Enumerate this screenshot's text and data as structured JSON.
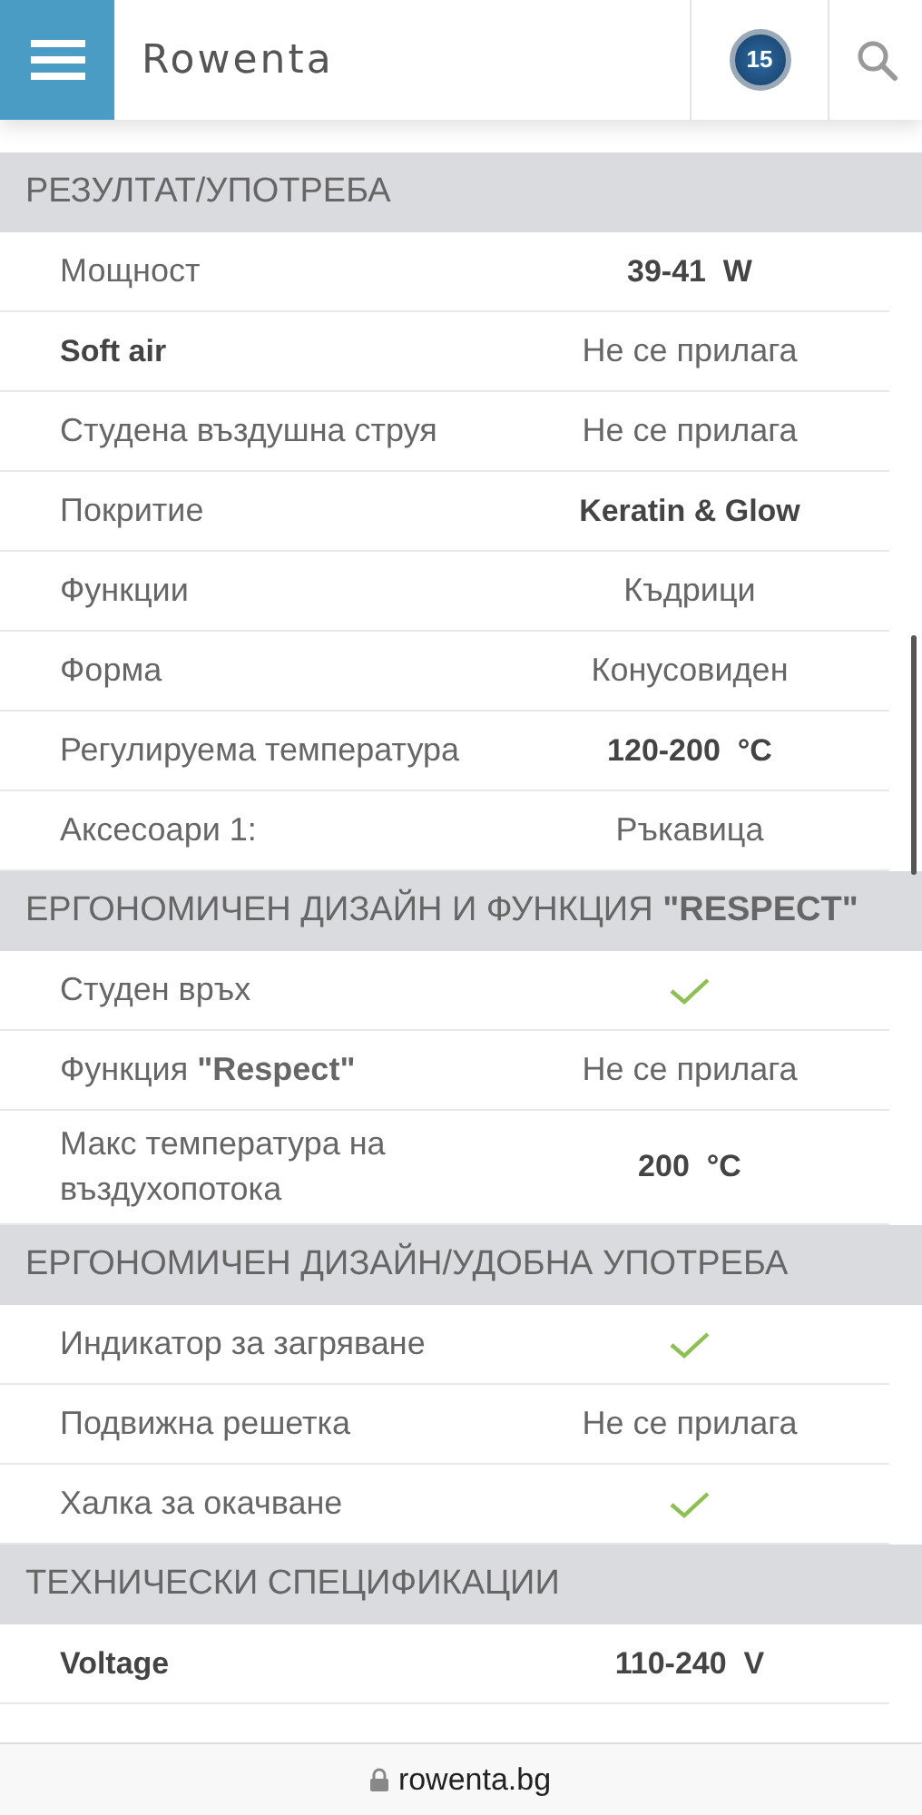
{
  "header": {
    "logo": "Rowenta",
    "badge": "15"
  },
  "sections": [
    {
      "title": "РЕЗУЛТАТ/УПОТРЕБА",
      "rows": [
        {
          "kind": "text",
          "label": "Мощност",
          "label_bold": false,
          "value": "39-41  W",
          "value_bold": true
        },
        {
          "kind": "text",
          "label": "Soft air",
          "label_bold": true,
          "value": "Не се прилага",
          "value_bold": false
        },
        {
          "kind": "text",
          "label": "Студена въздушна струя",
          "label_bold": false,
          "value": "Не се прилага",
          "value_bold": false
        },
        {
          "kind": "text",
          "label": "Покритие",
          "label_bold": false,
          "value": "Keratin & Glow",
          "value_bold": true
        },
        {
          "kind": "text",
          "label": "Функции",
          "label_bold": false,
          "value": "Къдрици",
          "value_bold": false
        },
        {
          "kind": "text",
          "label": "Форма",
          "label_bold": false,
          "value": "Конусовиден",
          "value_bold": false
        },
        {
          "kind": "text",
          "label": "Регулируема температура",
          "label_bold": false,
          "value": "120-200  °C",
          "value_bold": true
        },
        {
          "kind": "text",
          "label": "Аксесоари 1:",
          "label_bold": false,
          "value": "Ръкавица",
          "value_bold": false
        }
      ]
    },
    {
      "title": "ЕРГОНОМИЧЕН ДИЗАЙН И ФУНКЦИЯ **\"RESPECT\"**",
      "rows": [
        {
          "kind": "check",
          "label": "Студен връх",
          "label_bold": false,
          "checked": true
        },
        {
          "kind": "text",
          "label": "Функция **\"Respect\"**",
          "label_bold": false,
          "value": "Не се прилага",
          "value_bold": false
        },
        {
          "kind": "text",
          "label": "Макс температура на въздухопотока",
          "label_bold": false,
          "value": "200  °C",
          "value_bold": true
        }
      ]
    },
    {
      "title": "ЕРГОНОМИЧЕН ДИЗАЙН/УДОБНА УПОТРЕБА",
      "rows": [
        {
          "kind": "check",
          "label": "Индикатор за загряване",
          "label_bold": false,
          "checked": true
        },
        {
          "kind": "text",
          "label": "Подвижна решетка",
          "label_bold": false,
          "value": "Не се прилага",
          "value_bold": false
        },
        {
          "kind": "check",
          "label": "Халка за окачване",
          "label_bold": false,
          "checked": true
        }
      ]
    },
    {
      "title": "ТЕХНИЧЕСКИ СПЕЦИФИКАЦИИ",
      "rows": [
        {
          "kind": "text",
          "label": "Voltage",
          "label_bold": true,
          "value": "110-240  V",
          "value_bold": true
        }
      ]
    }
  ],
  "address_bar": {
    "url": "rowenta.bg"
  }
}
